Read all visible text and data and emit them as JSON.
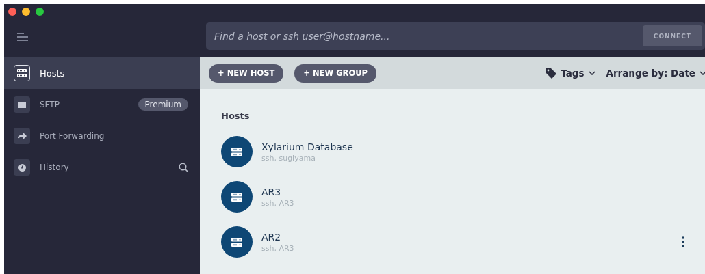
{
  "sidebar": {
    "items": [
      {
        "label": "Hosts",
        "kind": "server",
        "selected": true
      },
      {
        "label": "SFTP",
        "kind": "folder",
        "selected": false,
        "badge": "Premium"
      },
      {
        "label": "Port Forwarding",
        "kind": "forward",
        "selected": false
      },
      {
        "label": "History",
        "kind": "clock",
        "selected": false,
        "search": true
      }
    ]
  },
  "search": {
    "placeholder": "Find a host or ssh user@hostname...",
    "button": "CONNECT"
  },
  "toolbar": {
    "buttons": [
      "+ NEW HOST",
      "+ NEW GROUP"
    ],
    "tags": "Tags",
    "arrange": "Arrange by: Date"
  },
  "section_title": "Hosts",
  "hosts": [
    {
      "name": "Xylarium Database",
      "detail": "ssh, sugiyama",
      "menu": false
    },
    {
      "name": "AR3",
      "detail": "ssh, AR3",
      "menu": false
    },
    {
      "name": "AR2",
      "detail": "ssh, AR3",
      "menu": true
    }
  ]
}
